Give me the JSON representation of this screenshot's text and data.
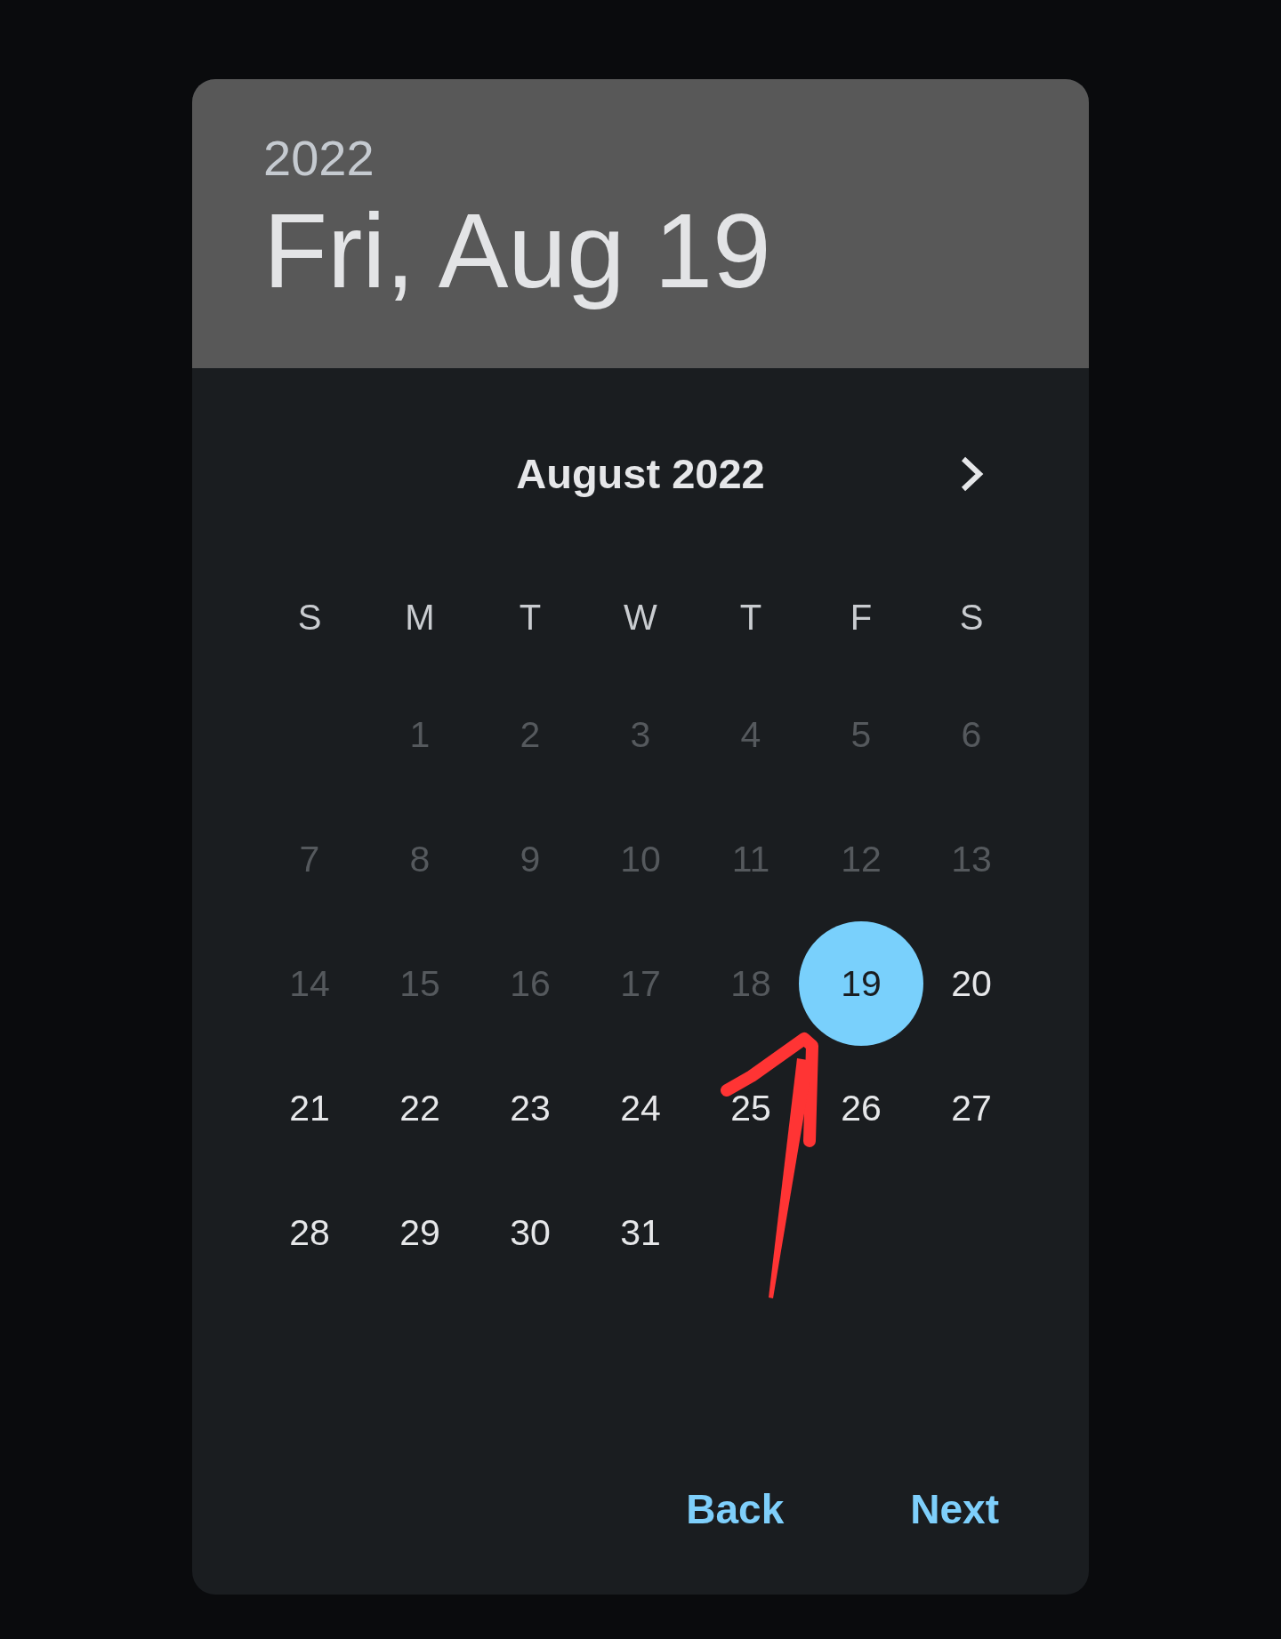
{
  "header": {
    "year": "2022",
    "date": "Fri, Aug 19"
  },
  "calendar": {
    "month": "August 2022",
    "weekdays": [
      "S",
      "M",
      "T",
      "W",
      "T",
      "F",
      "S"
    ],
    "weeks": [
      {
        "days": [
          {
            "label": "1",
            "disabled": true,
            "selected": false
          },
          {
            "label": "2",
            "disabled": true,
            "selected": false
          },
          {
            "label": "3",
            "disabled": true,
            "selected": false
          },
          {
            "label": "4",
            "disabled": true,
            "selected": false
          },
          {
            "label": "5",
            "disabled": true,
            "selected": false
          },
          {
            "label": "6",
            "disabled": true,
            "selected": false
          }
        ]
      },
      {
        "days": [
          {
            "label": "7",
            "disabled": true,
            "selected": false
          },
          {
            "label": "8",
            "disabled": true,
            "selected": false
          },
          {
            "label": "9",
            "disabled": true,
            "selected": false
          },
          {
            "label": "10",
            "disabled": true,
            "selected": false
          },
          {
            "label": "11",
            "disabled": true,
            "selected": false
          },
          {
            "label": "12",
            "disabled": true,
            "selected": false
          },
          {
            "label": "13",
            "disabled": true,
            "selected": false
          }
        ]
      },
      {
        "days": [
          {
            "label": "14",
            "disabled": true,
            "selected": false
          },
          {
            "label": "15",
            "disabled": true,
            "selected": false
          },
          {
            "label": "16",
            "disabled": true,
            "selected": false
          },
          {
            "label": "17",
            "disabled": true,
            "selected": false
          },
          {
            "label": "18",
            "disabled": true,
            "selected": false
          },
          {
            "label": "19",
            "disabled": false,
            "selected": true
          },
          {
            "label": "20",
            "disabled": false,
            "selected": false
          }
        ]
      },
      {
        "days": [
          {
            "label": "21",
            "disabled": false,
            "selected": false
          },
          {
            "label": "22",
            "disabled": false,
            "selected": false
          },
          {
            "label": "23",
            "disabled": false,
            "selected": false
          },
          {
            "label": "24",
            "disabled": false,
            "selected": false
          },
          {
            "label": "25",
            "disabled": false,
            "selected": false
          },
          {
            "label": "26",
            "disabled": false,
            "selected": false
          },
          {
            "label": "27",
            "disabled": false,
            "selected": false
          }
        ]
      },
      {
        "days": [
          {
            "label": "28",
            "disabled": false,
            "selected": false
          },
          {
            "label": "29",
            "disabled": false,
            "selected": false
          },
          {
            "label": "30",
            "disabled": false,
            "selected": false
          },
          {
            "label": "31",
            "disabled": false,
            "selected": false
          }
        ]
      }
    ]
  },
  "actions": [
    "Back",
    "Next"
  ],
  "annotation": {
    "kind": "arrow"
  }
}
